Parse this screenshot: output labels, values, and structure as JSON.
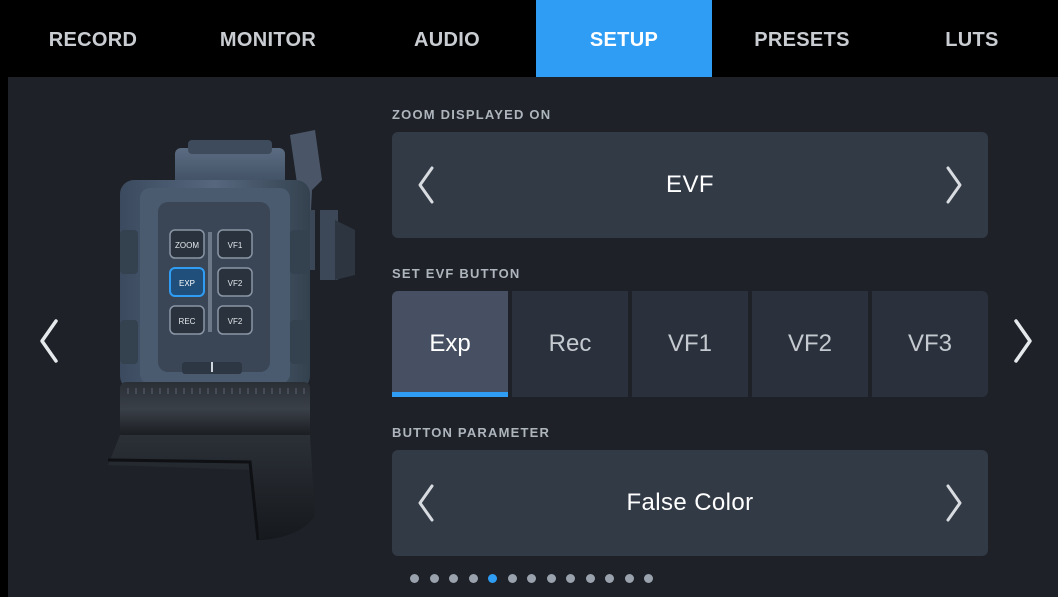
{
  "tabs": [
    {
      "label": "RECORD",
      "active": false
    },
    {
      "label": "MONITOR",
      "active": false
    },
    {
      "label": "AUDIO",
      "active": false
    },
    {
      "label": "SETUP",
      "active": true
    },
    {
      "label": "PRESETS",
      "active": false
    },
    {
      "label": "LUTS",
      "active": false
    }
  ],
  "zoom_displayed_on": {
    "label": "ZOOM DISPLAYED ON",
    "value": "EVF"
  },
  "set_evf_button": {
    "label": "SET EVF BUTTON",
    "options": [
      "Exp",
      "Rec",
      "VF1",
      "VF2",
      "VF3"
    ],
    "selected": "Exp"
  },
  "button_parameter": {
    "label": "BUTTON PARAMETER",
    "value": "False Color"
  },
  "camera_illustration": {
    "buttons": [
      "ZOOM",
      "VF1",
      "EXP",
      "VF2",
      "REC",
      "VF2"
    ],
    "highlighted": "EXP"
  },
  "pagination": {
    "total": 13,
    "current": 5
  },
  "colors": {
    "accent": "#2f9df4",
    "panel": "#323a46",
    "background": "#1e2228"
  }
}
